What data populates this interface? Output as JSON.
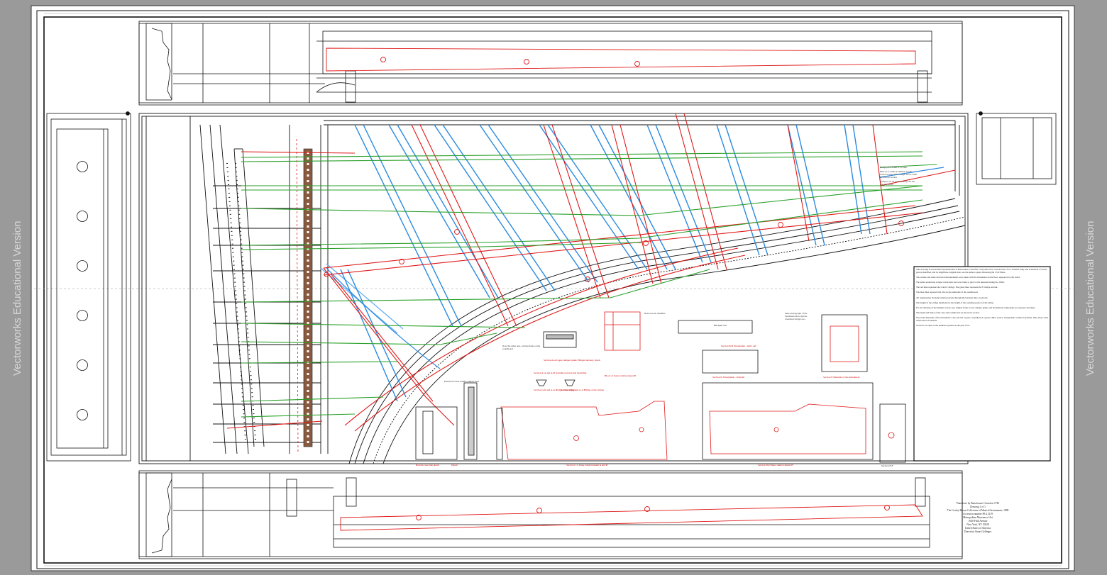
{
  "watermark": {
    "left": "Vectorworks Educational Version",
    "right": "Vectorworks Educational Version"
  },
  "title_block": {
    "lines": [
      "Pianoforte by Bartolomeo Cristofori 1720",
      "Drawing 1 of 1",
      "The Crosby Brown Collection of Musical Instruments, 1889",
      "Accession number 89.4.1219",
      "Metropolitan Museum of Art",
      "1000 Fifth Avenue",
      "New York, NY 10028",
      "United States of America",
      "Drawn by Stuart Gellinger"
    ]
  },
  "notes": {
    "paragraphs": [
      "This drawing is an idealized representation of Bartolomeo Cristofori 1720 piano in its current state. For a detailed study and evaluation of all the pieces identified, and its lengthwise original state, see the authors paper discussing the 1720 Piano.",
      "The outline and some structural measurements were taken with the instrument on the floor, supported by the stand.",
      "The piano underwent a major restoration and was strung to pitch at the museum during the 1930s.",
      "The red lines represent the 2 and 4' strings. The green lines represent the 8' bridge and nut.",
      "The blue lines represent the ribs on the underside of the soundboard.",
      "All original glue blocking which protrude through the bentside liner are shown.",
      "The length of the strings mentioned is the length of the sounding portion of the string.",
      "For the drawing of the hammer action, key, damper frame, lower damper guide, and mechanical components see separate drawings.",
      "The depth and shape of the case and soundboard are shown in section.",
      "Wood and materials of the instrument: Case and lid: cypress. Soundboard: cypress. Ribs: spruce. Wrestplank: walnut. Keyframe: lime. Keys: lime with boxwood naturals.",
      "Sections are taken at the numbered points on the plan view."
    ]
  },
  "section_captions": [
    "Section A-A Upper damper guide: Hinged and key check",
    "Section A-A and A-B Soundboard and side moulding",
    "Section Left end A-A Bridge at the strings",
    "Section Right end A-A Bridge at the strings",
    "Detail of lower reinforcement strut",
    "Block of inner reinforcement B",
    "Section B-B Wrestplank - belly rail",
    "Section D Wrestplank - bellyrail",
    "Section E Bentside of the instrument",
    "Section C-C Inner reinforcement A and B",
    "Section D-D Inner reinforcement B",
    "Section F-F",
    "Bottom case side detail",
    "Detail",
    "Hitchpin rail",
    "Bridge pin 0.8 mm to 1.0 mm",
    "Ribs are 5.0 mm in diameter for the lowest section of the bridge, and 5.5 mm for the low section",
    "Dampers are all 2.6 mm except for the last one drawn",
    "Boxwood nut dummies",
    "Note the rather neat, written marks on the soundboard",
    "Inner photographs of the instrument show that the lowermost strings are..."
  ],
  "colors": {
    "sheet": "#ffffff",
    "ink": "#1a1a1a",
    "strings_red": "#e01818",
    "strings_blue": "#2a8ae0",
    "strings_green": "#2aa02a",
    "keyboard_wood": "#8a5a40",
    "margin_gray": "#9a9a9a"
  },
  "icons": {
    "pin_hole": "circle-icon",
    "section_marker": "circled-number-icon"
  }
}
